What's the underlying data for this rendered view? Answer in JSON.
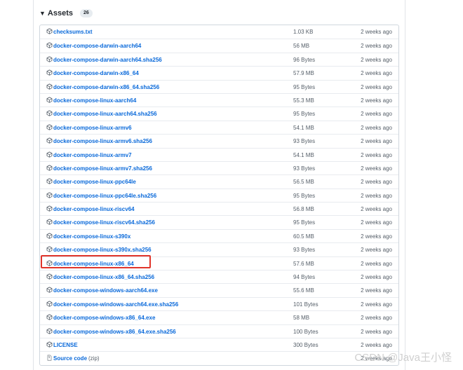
{
  "assets": {
    "title": "Assets",
    "count": "26",
    "items": [
      {
        "name": "checksums.txt",
        "size": "1.03 KB",
        "date": "2 weeks ago",
        "icon": "package-icon"
      },
      {
        "name": "docker-compose-darwin-aarch64",
        "size": "56 MB",
        "date": "2 weeks ago",
        "icon": "package-icon"
      },
      {
        "name": "docker-compose-darwin-aarch64.sha256",
        "size": "96 Bytes",
        "date": "2 weeks ago",
        "icon": "package-icon"
      },
      {
        "name": "docker-compose-darwin-x86_64",
        "size": "57.9 MB",
        "date": "2 weeks ago",
        "icon": "package-icon"
      },
      {
        "name": "docker-compose-darwin-x86_64.sha256",
        "size": "95 Bytes",
        "date": "2 weeks ago",
        "icon": "package-icon"
      },
      {
        "name": "docker-compose-linux-aarch64",
        "size": "55.3 MB",
        "date": "2 weeks ago",
        "icon": "package-icon"
      },
      {
        "name": "docker-compose-linux-aarch64.sha256",
        "size": "95 Bytes",
        "date": "2 weeks ago",
        "icon": "package-icon"
      },
      {
        "name": "docker-compose-linux-armv6",
        "size": "54.1 MB",
        "date": "2 weeks ago",
        "icon": "package-icon"
      },
      {
        "name": "docker-compose-linux-armv6.sha256",
        "size": "93 Bytes",
        "date": "2 weeks ago",
        "icon": "package-icon"
      },
      {
        "name": "docker-compose-linux-armv7",
        "size": "54.1 MB",
        "date": "2 weeks ago",
        "icon": "package-icon"
      },
      {
        "name": "docker-compose-linux-armv7.sha256",
        "size": "93 Bytes",
        "date": "2 weeks ago",
        "icon": "package-icon"
      },
      {
        "name": "docker-compose-linux-ppc64le",
        "size": "56.5 MB",
        "date": "2 weeks ago",
        "icon": "package-icon"
      },
      {
        "name": "docker-compose-linux-ppc64le.sha256",
        "size": "95 Bytes",
        "date": "2 weeks ago",
        "icon": "package-icon"
      },
      {
        "name": "docker-compose-linux-riscv64",
        "size": "56.8 MB",
        "date": "2 weeks ago",
        "icon": "package-icon"
      },
      {
        "name": "docker-compose-linux-riscv64.sha256",
        "size": "95 Bytes",
        "date": "2 weeks ago",
        "icon": "package-icon"
      },
      {
        "name": "docker-compose-linux-s390x",
        "size": "60.5 MB",
        "date": "2 weeks ago",
        "icon": "package-icon"
      },
      {
        "name": "docker-compose-linux-s390x.sha256",
        "size": "93 Bytes",
        "date": "2 weeks ago",
        "icon": "package-icon"
      },
      {
        "name": "docker-compose-linux-x86_64",
        "size": "57.6 MB",
        "date": "2 weeks ago",
        "icon": "package-icon"
      },
      {
        "name": "docker-compose-linux-x86_64.sha256",
        "size": "94 Bytes",
        "date": "2 weeks ago",
        "icon": "package-icon"
      },
      {
        "name": "docker-compose-windows-aarch64.exe",
        "size": "55.6 MB",
        "date": "2 weeks ago",
        "icon": "package-icon"
      },
      {
        "name": "docker-compose-windows-aarch64.exe.sha256",
        "size": "101 Bytes",
        "date": "2 weeks ago",
        "icon": "package-icon"
      },
      {
        "name": "docker-compose-windows-x86_64.exe",
        "size": "58 MB",
        "date": "2 weeks ago",
        "icon": "package-icon"
      },
      {
        "name": "docker-compose-windows-x86_64.exe.sha256",
        "size": "100 Bytes",
        "date": "2 weeks ago",
        "icon": "package-icon"
      },
      {
        "name": "LICENSE",
        "size": "300 Bytes",
        "date": "2 weeks ago",
        "icon": "package-icon"
      },
      {
        "name": "Source code",
        "suffix": "(zip)",
        "size": "",
        "date": "2 weeks ago",
        "icon": "file-zip-icon"
      }
    ]
  },
  "watermark": "CSDN @Java王小怪",
  "colors": {
    "link": "#0969da",
    "muted": "#57606a",
    "highlight": "#e0342a"
  }
}
